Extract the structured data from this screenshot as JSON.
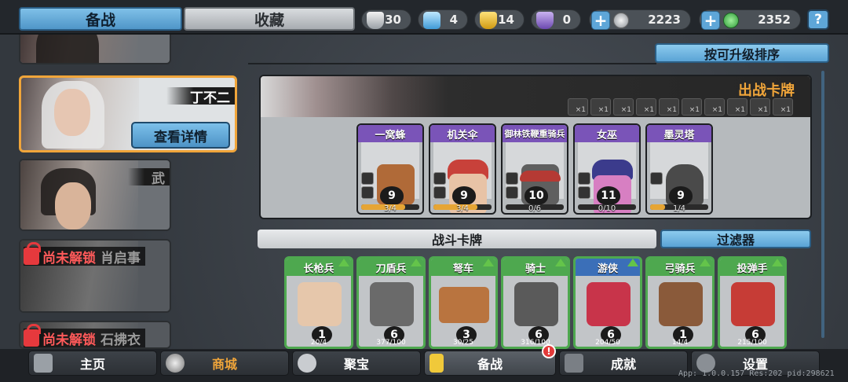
{
  "tabs": {
    "prep": "备战",
    "collection": "收藏"
  },
  "resources": {
    "silver_shield": "30",
    "blue_crystal": "4",
    "gold_shield": "14",
    "purple_shield": "0",
    "silver_coin": "2223",
    "green_gem": "2352"
  },
  "help_label": "?",
  "sort_label": "按可升级排序",
  "heroes": [
    {
      "name": "丁不二",
      "detail": "查看详情"
    },
    {
      "name": "武"
    },
    {
      "locked": "尚未解锁",
      "name": "肖启事"
    },
    {
      "locked": "尚未解锁",
      "name": "石拂衣"
    }
  ],
  "deck": {
    "title": "出战卡牌",
    "slot_counts": [
      "×1",
      "×1",
      "×1",
      "×1",
      "×1",
      "×1",
      "×1",
      "×1",
      "×1",
      "×1"
    ],
    "cards": [
      {
        "name": "一窝蜂",
        "level": "9",
        "count": "3/4",
        "progress": 0.75
      },
      {
        "name": "机关伞",
        "level": "9",
        "count": "3/4",
        "progress": 0.75
      },
      {
        "name": "御林铁鞭重骑兵",
        "level": "10",
        "count": "0/6",
        "progress": 0.0
      },
      {
        "name": "女巫",
        "level": "11",
        "count": "0/10",
        "progress": 0.0
      },
      {
        "name": "墨灵塔",
        "level": "9",
        "count": "1/4",
        "progress": 0.25
      }
    ]
  },
  "battle": {
    "title": "战斗卡牌",
    "filter": "过滤器",
    "cards": [
      {
        "name": "长枪兵",
        "level": "1",
        "count": "20/4"
      },
      {
        "name": "刀盾兵",
        "level": "6",
        "count": "377/100"
      },
      {
        "name": "弩车",
        "level": "3",
        "count": "30/25"
      },
      {
        "name": "骑士",
        "level": "6",
        "count": "316/100"
      },
      {
        "name": "游侠",
        "level": "6",
        "count": "204/50"
      },
      {
        "name": "弓骑兵",
        "level": "1",
        "count": "14/4"
      },
      {
        "name": "投弹手",
        "level": "6",
        "count": "215/100"
      }
    ]
  },
  "nav": {
    "home": "主页",
    "shop": "商城",
    "treasure": "聚宝",
    "prep": "备战",
    "achieve": "成就",
    "settings": "设置"
  },
  "badge": "!",
  "version": "App: 1.0.0.157 Res:202 pid:298621"
}
